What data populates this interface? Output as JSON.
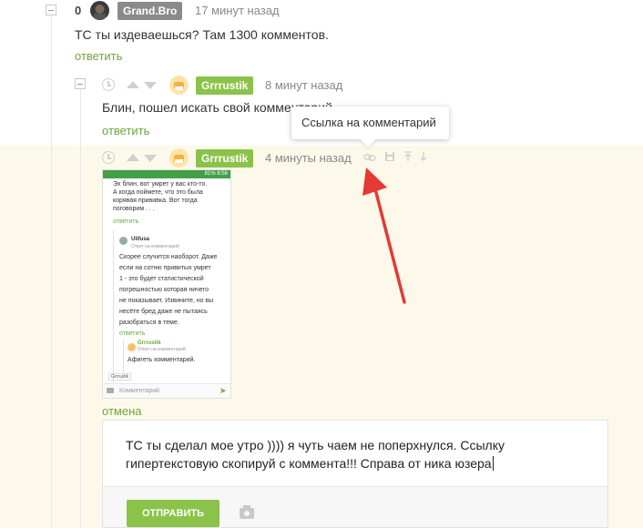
{
  "comment1": {
    "rating": "0",
    "nick": "Grand.Bro",
    "time": "17 минут назад",
    "text": "ТС ты издеваешься? Там 1300 комментов.",
    "reply": "ответить"
  },
  "comment2": {
    "nick": "Grrrustik",
    "time": "8 минут назад",
    "text": "Блин, пошел искать свой комментарий",
    "reply": "ответить"
  },
  "comment3": {
    "nick": "Grrrustik",
    "time": "4 минуты назад",
    "screenshot": {
      "status": "81% 8:56",
      "lines": [
        "Эх блин, вот умрет у вас кто-то.",
        "А когда поймете, что это была",
        "корявая прививка. Вот тогда",
        "поговорим . . ."
      ],
      "reply1": "ответить",
      "nested_nick": "Ulifusa",
      "nested_meta": "Ответ на комментарий",
      "nested_lines": [
        "Скорее случится наоборот. Даже",
        "если на сотню привитых умрет",
        "1 - это будет статистической",
        "погрешностью которая ничего",
        "не показывает. Извините, но вы",
        "несёте бред даже не пытаясь",
        "разобраться в теме."
      ],
      "reply2": "ответить",
      "deep_nick": "Grrrustik",
      "deep_meta": "Ответ на комментарий",
      "deep_text": "Афигеть комментарий.",
      "input_tag": "Grrrustik",
      "input_placeholder": "Комментарий"
    },
    "cancel": "отмена"
  },
  "tooltip": "Ссылка на комментарий",
  "editor": {
    "text_line1": "ТС ты сделал мое утро ))))  я чуть чаем не поперхнулся. Ссылку",
    "text_line2": "гипертекстовую скопируй с коммента!!! Справа от ника юзера",
    "send_label": "ОТПРАВИТЬ"
  },
  "colors": {
    "accent": "#8bc34a",
    "link": "#6ca73a",
    "highlight_bg": "#fdf9ea",
    "arrow": "#e53935"
  }
}
